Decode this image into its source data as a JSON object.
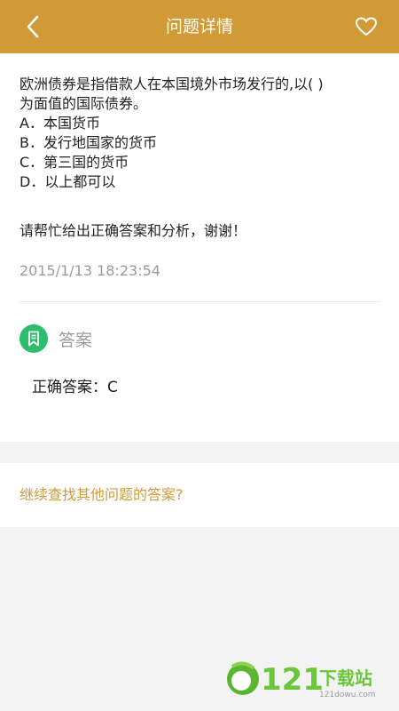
{
  "header": {
    "title": "问题详情",
    "back_icon": "chevron-left-icon",
    "favorite_icon": "heart-outline-icon"
  },
  "question": {
    "lines": [
      "欧洲债券是指借款人在本国境外市场发行的,以( )",
      "为面值的国际债券。",
      "A．本国货币",
      "B．发行地国家的货币",
      "C．第三国的货币",
      "D．以上都可以"
    ],
    "request": "请帮忙给出正确答案和分析，谢谢！",
    "timestamp": "2015/1/13 18:23:54"
  },
  "answer": {
    "label": "答案",
    "icon": "bookmark-icon",
    "text": "正确答案：C"
  },
  "more": {
    "link_text": "继续查找其他问题的答案?"
  },
  "watermark": {
    "text": "121下载站",
    "url_text": "121dowu.com"
  },
  "colors": {
    "header_bg": "#d09b37",
    "accent": "#d09b37",
    "answer_icon_bg": "#2dbd6e",
    "muted_text": "#9a9a9a",
    "page_bg": "#f3f3f3"
  }
}
